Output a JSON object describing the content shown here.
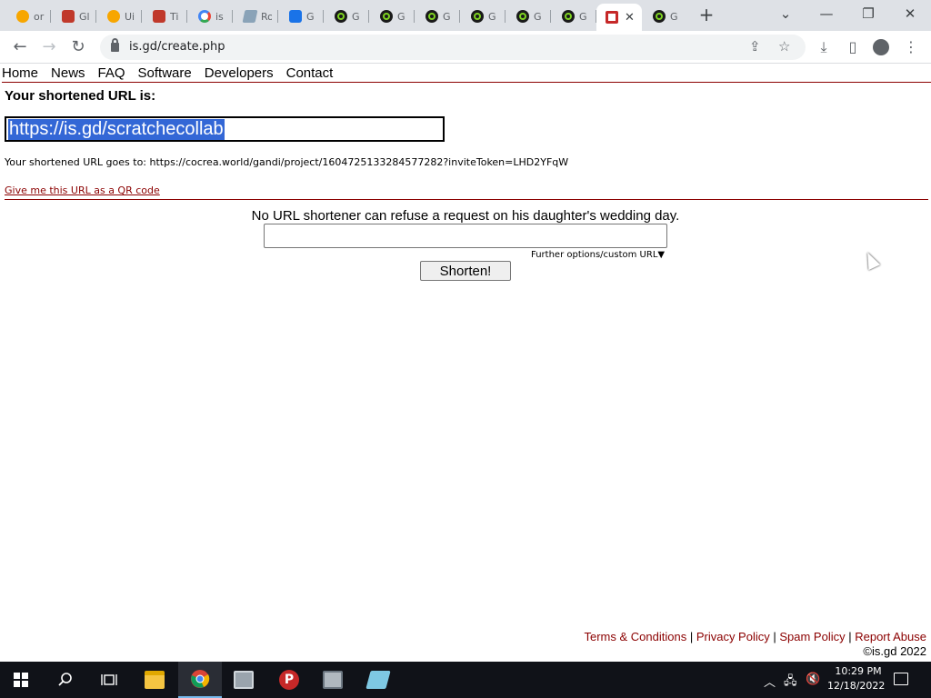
{
  "browser": {
    "tabs": [
      {
        "title": "or",
        "icon": "bitcoin-icon"
      },
      {
        "title": "Gl",
        "icon": "red-app-icon"
      },
      {
        "title": "Ui",
        "icon": "bitcoin-icon"
      },
      {
        "title": "Ti",
        "icon": "red-app-icon"
      },
      {
        "title": "is",
        "icon": "google-icon"
      },
      {
        "title": "Ro",
        "icon": "paper-icon"
      },
      {
        "title": "G",
        "icon": "blue-g-icon"
      },
      {
        "title": "G",
        "icon": "ring-icon"
      },
      {
        "title": "G",
        "icon": "ring-icon"
      },
      {
        "title": "G",
        "icon": "ring-icon"
      },
      {
        "title": "G",
        "icon": "ring-icon"
      },
      {
        "title": "G",
        "icon": "ring-icon"
      },
      {
        "title": "G",
        "icon": "ring-icon"
      },
      {
        "title": "",
        "icon": "isgd-icon",
        "active": true
      },
      {
        "title": "G",
        "icon": "ring-icon"
      }
    ],
    "address": "is.gd/create.php"
  },
  "site": {
    "nav": [
      "Home",
      "News",
      "FAQ",
      "Software",
      "Developers",
      "Contact"
    ],
    "result_label": "Your shortened URL is:",
    "short_url": "https://is.gd/scratchecollab",
    "goes_to_prefix": "Your shortened URL goes to: ",
    "goes_to_url": "https://cocrea.world/gandi/project/1604725133284577282?inviteToken=LHD2YFqW",
    "qr_link": "Give me this URL as a QR code",
    "tagline": "No URL shortener can refuse a request on his daughter's wedding day.",
    "long_url_value": "",
    "further_options": "Further options/custom URL▼",
    "shorten_label": "Shorten!",
    "footer": {
      "terms": "Terms & Conditions",
      "privacy": "Privacy Policy",
      "spam": "Spam Policy",
      "abuse": "Report Abuse",
      "sep": " | ",
      "copyright": "©is.gd 2022"
    }
  },
  "taskbar": {
    "time": "10:29 PM",
    "date": "12/18/2022"
  },
  "colors": {
    "site_accent": "#8b0000",
    "selection": "#3367d6",
    "taskbar": "#101218",
    "tabstrip": "#dee1e6"
  }
}
